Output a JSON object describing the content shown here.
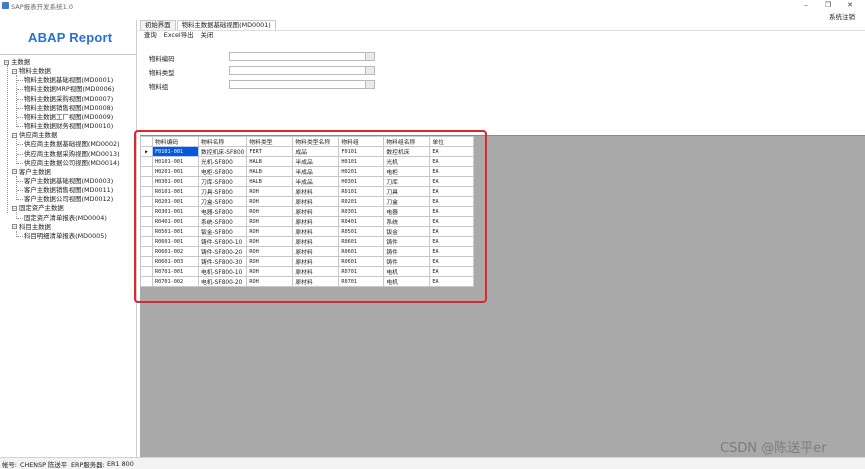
{
  "window": {
    "title": "SAP报表开发系统1.0",
    "controls": [
      "–",
      "❐",
      "✕"
    ]
  },
  "topbar": {
    "logout": "系统注销"
  },
  "sidebar": {
    "logo": "ABAP Report",
    "tree": [
      {
        "label": "主数据",
        "level": 0,
        "toggle": "−"
      },
      {
        "label": "物料主数据",
        "level": 1,
        "toggle": "−"
      },
      {
        "label": "物料主数据基础视图(MD0001)",
        "level": 2
      },
      {
        "label": "物料主数据MRP视图(MD0006)",
        "level": 2
      },
      {
        "label": "物料主数据采购视图(MD0007)",
        "level": 2
      },
      {
        "label": "物料主数据销售视图(MD0008)",
        "level": 2
      },
      {
        "label": "物料主数据工厂视图(MD0009)",
        "level": 2
      },
      {
        "label": "物料主数据财务视图(MD0010)",
        "level": 2
      },
      {
        "label": "供应商主数据",
        "level": 1,
        "toggle": "−"
      },
      {
        "label": "供应商主数据基础视图(MD0002)",
        "level": 2
      },
      {
        "label": "供应商主数据采购视图(MD0013)",
        "level": 2
      },
      {
        "label": "供应商主数据公司视图(MD0014)",
        "level": 2
      },
      {
        "label": "客户主数据",
        "level": 1,
        "toggle": "−"
      },
      {
        "label": "客户主数据基础视图(MD0003)",
        "level": 2
      },
      {
        "label": "客户主数据销售视图(MD0011)",
        "level": 2
      },
      {
        "label": "客户主数据公司视图(MD0012)",
        "level": 2
      },
      {
        "label": "固定资产主数据",
        "level": 1,
        "toggle": "−"
      },
      {
        "label": "固定资产清单报表(MD0004)",
        "level": 2
      },
      {
        "label": "科目主数据",
        "level": 1,
        "toggle": "−"
      },
      {
        "label": "科目明细清单报表(MD0005)",
        "level": 2
      }
    ]
  },
  "tabs": [
    {
      "label": "初始界面",
      "active": false
    },
    {
      "label": "物料主数据基础视图(MD0001)",
      "active": true
    }
  ],
  "toolbar": {
    "query": "查询",
    "excel": "Excel导出",
    "close": "关闭"
  },
  "form": {
    "material_code": {
      "label": "物料编码",
      "value": ""
    },
    "material_type": {
      "label": "物料类型",
      "value": ""
    },
    "material_group": {
      "label": "物料组",
      "value": ""
    }
  },
  "grid": {
    "columns": [
      "物料编码",
      "物料名称",
      "物料类型",
      "物料类型名称",
      "物料组",
      "物料组名称",
      "单位"
    ],
    "row_marker": "▶",
    "rows": [
      [
        "F0101-001",
        "数控机床-SF800",
        "FERT",
        "成品",
        "F0101",
        "数控机床",
        "EA"
      ],
      [
        "H0101-001",
        "光机-SF800",
        "HALB",
        "半成品",
        "H0101",
        "光机",
        "EA"
      ],
      [
        "H0201-001",
        "电柜-SF800",
        "HALB",
        "半成品",
        "H0201",
        "电柜",
        "EA"
      ],
      [
        "H0301-001",
        "刀库-SF800",
        "HALB",
        "半成品",
        "H0301",
        "刀库",
        "EA"
      ],
      [
        "R0101-001",
        "刀具-SF800",
        "ROH",
        "原材料",
        "R0101",
        "刀具",
        "EA"
      ],
      [
        "R0201-001",
        "刀盒-SF800",
        "ROH",
        "原材料",
        "R0201",
        "刀盒",
        "EA"
      ],
      [
        "R0301-001",
        "电器-SF800",
        "ROH",
        "原材料",
        "R0301",
        "电器",
        "EA"
      ],
      [
        "R0401-001",
        "系统-SF800",
        "ROH",
        "原材料",
        "R0401",
        "系统",
        "EA"
      ],
      [
        "R0501-001",
        "钣金-SF800",
        "ROH",
        "原材料",
        "R0501",
        "钣金",
        "EA"
      ],
      [
        "R0601-001",
        "铸件-SF800-10",
        "ROH",
        "原材料",
        "R0601",
        "铸件",
        "EA"
      ],
      [
        "R0601-002",
        "铸件-SF800-20",
        "ROH",
        "原材料",
        "R0601",
        "铸件",
        "EA"
      ],
      [
        "R0601-003",
        "铸件-SF800-30",
        "ROH",
        "原材料",
        "R0601",
        "铸件",
        "EA"
      ],
      [
        "R0701-001",
        "电机-SF800-10",
        "ROH",
        "原材料",
        "R0701",
        "电机",
        "EA"
      ],
      [
        "R0701-002",
        "电机-SF800-20",
        "ROH",
        "原材料",
        "R0701",
        "电机",
        "EA"
      ]
    ]
  },
  "status": {
    "account": "帐号:",
    "user": "CHENSP  陈送平",
    "erp": "ERP服务器:",
    "server": "ER1  800"
  },
  "watermark": "CSDN @陈送平er",
  "colors": {
    "logo": "#2b6fd1",
    "selection": "#0a57d6",
    "highlight_frame": "#e0262b",
    "grid_background": "#a9a9a9"
  }
}
